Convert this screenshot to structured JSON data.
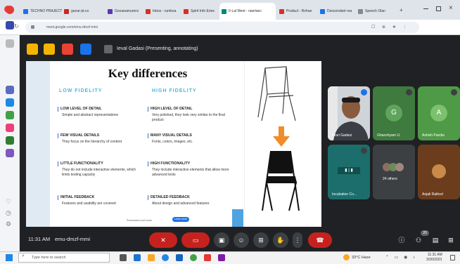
{
  "browser": {
    "tabs": [
      {
        "label": "TECHNO PRAJECT"
      },
      {
        "label": "gunar-pt.co"
      },
      {
        "label": "Gooaeamuronc"
      },
      {
        "label": "Inbox - rumbsa"
      },
      {
        "label": "Spirit Info Eries"
      },
      {
        "label": "II-Lal Meet - rawrlaec",
        "active": true
      },
      {
        "label": "Product - Rohan"
      },
      {
        "label": "Descendant rea"
      },
      {
        "label": "Speech Olan"
      }
    ],
    "url": "meet.google.com/emu-dmzf-mmi"
  },
  "meet": {
    "presenter_label": "Ieval Gadasi (Presenting, annotating)",
    "time": "11:31 AM",
    "meeting_code": "emu-dmzf-mmi",
    "participant_count": "20",
    "tiles": [
      {
        "name": "Inlari Gadasi",
        "type": "video"
      },
      {
        "name": "Ghanshyam U.",
        "initial": "G",
        "color": "#3a8a3a"
      },
      {
        "name": "Ashish Pandia",
        "initial": "A",
        "color": "#4caf50"
      },
      {
        "name": "Incubation Co...",
        "type": "screen"
      },
      {
        "name": "24 others",
        "type": "others"
      },
      {
        "name": "Anjali Rathod",
        "type": "photo"
      }
    ]
  },
  "slide": {
    "title": "Key differences",
    "low_heading": "LOW FIDELITY",
    "high_heading": "HIGH FIDELITY",
    "low_items": [
      {
        "h": "LOW LEVEL OF DETAIL",
        "b": "Simple and abstract representations"
      },
      {
        "h": "FEW VISUAL DETAILS",
        "b": "They focus on the hierarchy of content"
      },
      {
        "h": "LITTLE FUNCTIONALITY",
        "b": "They do not include interactive elements, which limits testing capacity"
      },
      {
        "h": "INITIAL FEEDBACK",
        "b": "Features and usability are covered"
      }
    ],
    "high_items": [
      {
        "h": "HIGH LEVEL OF DETAIL",
        "b": "Very polished, they look very similar to the final product"
      },
      {
        "h": "MANY VISUAL DETAILS",
        "b": "Fonts, colors, images, etc."
      },
      {
        "h": "HIGH FUNCTIONALITY",
        "b": "They include interactive elements that allow more advanced tests"
      },
      {
        "h": "DETAILED FEEDBACK",
        "b": "About design and advanced features"
      }
    ],
    "footer_text": "Presentation tool footer",
    "footer_button": "Learn more"
  },
  "taskbar": {
    "search_placeholder": "Type here to search",
    "weather": "33°C Haze",
    "clock_time": "11:31 AM",
    "clock_date": "3/30/2023"
  }
}
